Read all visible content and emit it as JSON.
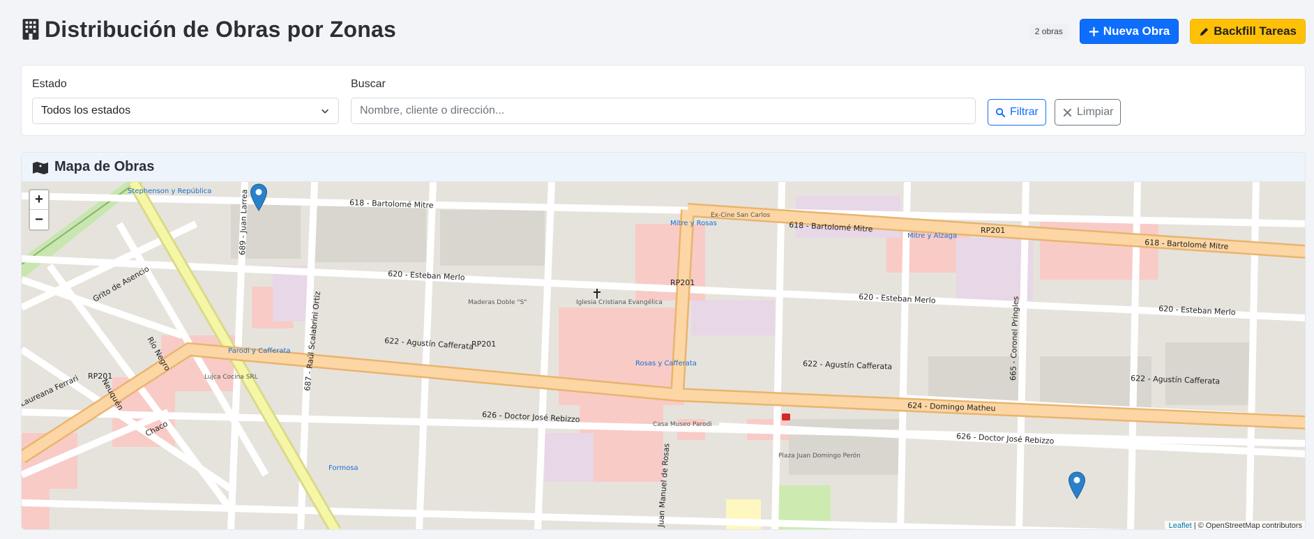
{
  "header": {
    "title": "Distribución de Obras por Zonas",
    "count_badge": "2 obras",
    "new_button": "Nueva Obra",
    "backfill_button": "Backfill Tareas"
  },
  "filters": {
    "estado_label": "Estado",
    "estado_value": "Todos los estados",
    "buscar_label": "Buscar",
    "buscar_placeholder": "Nombre, cliente o dirección...",
    "filter_button": "Filtrar",
    "clear_button": "Limpiar"
  },
  "map": {
    "title": "Mapa de Obras",
    "zoom_in": "+",
    "zoom_out": "−",
    "attribution_leaflet": "Leaflet",
    "attribution_rest": "| © OpenStreetMap contributors",
    "street_labels": {
      "mitre": "618 - Bartolomé Mitre",
      "merlo": "620 - Esteban Merlo",
      "cafferata": "622 - Agustín Cafferata",
      "matheu": "624 - Domingo Matheu",
      "rebizzo": "626 - Doctor José Rebizzo",
      "rp201": "RP201",
      "rosas": "Juan Manuel de Rosas",
      "scalabrini": "687 - Raúl Scalabrini Ortiz",
      "larrea": "689 - Juan Larrea",
      "pringles": "665 - Coronel Pringles",
      "rionegro": "Río Negro",
      "neuquen": "Neuquén",
      "chaco": "Chaco",
      "ferrari": "Laureana Ferrari",
      "grito": "Grito de Asencio"
    },
    "places": {
      "excine": "Ex-Cine San Carlos",
      "iglesia": "Iglesia Cristiana Evangélica",
      "maderas": "Maderas Doble \"S\"",
      "lujca": "Lujca Cocina SRL",
      "casamuseo": "Casa Museo Parodi",
      "plaza": "Plaza Juan Domingo Perón",
      "stephenson": "Stephenson y República",
      "parodi": "Parodi y Cafferata",
      "mitrerosas": "Mitre y Rosas",
      "rosascafferata": "Rosas y Cafferata",
      "mitrealzaga": "Mitre y Alzaga",
      "formosa": "Formosa"
    },
    "markers_count": 2
  },
  "colors": {
    "primary": "#0d6efd",
    "warning": "#ffc107",
    "road_main": "#fcd6a4",
    "building_pink": "#f9c8c4",
    "marker": "#2a81cb"
  }
}
